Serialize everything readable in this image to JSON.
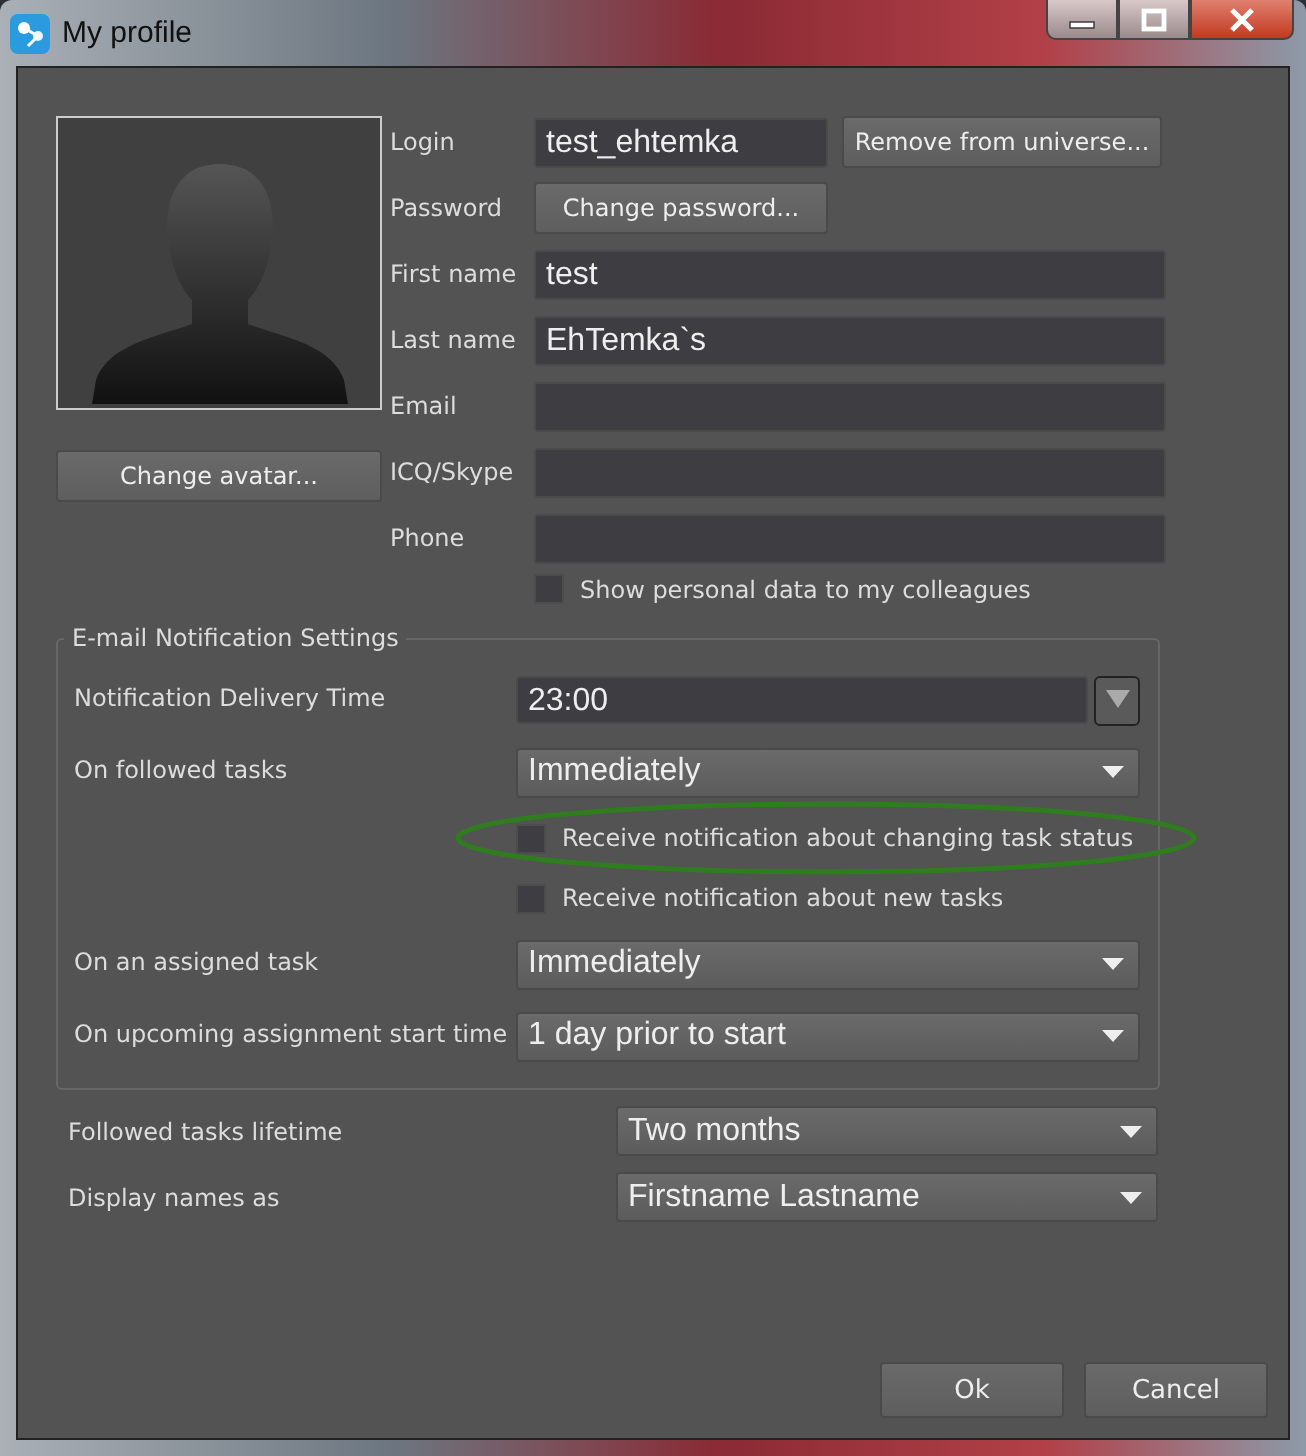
{
  "window": {
    "title": "My profile"
  },
  "profile": {
    "change_avatar": "Change avatar...",
    "fields": [
      {
        "label": "Login",
        "kind": "input",
        "value": "test_ehtemka",
        "button": "Remove from universe..."
      },
      {
        "label": "Password",
        "kind": "button",
        "button": "Change password..."
      },
      {
        "label": "First name",
        "kind": "input",
        "value": "test"
      },
      {
        "label": "Last name",
        "kind": "input",
        "value": "EhTemka`s"
      },
      {
        "label": "Email",
        "kind": "input"
      },
      {
        "label": "ICQ/Skype",
        "kind": "input"
      },
      {
        "label": "Phone",
        "kind": "input"
      }
    ],
    "show_personal": {
      "label": "Show personal data to my colleagues",
      "checked": false
    }
  },
  "notifications": {
    "title": "E-mail Notification Settings",
    "rows": [
      {
        "kind": "time",
        "label": "Notification Delivery Time",
        "value": "23:00"
      },
      {
        "kind": "combo",
        "label": "On followed tasks",
        "value": "Immediately"
      },
      {
        "kind": "checkbox",
        "label": "Receive notification about changing task status",
        "checked": false,
        "highlighted": true
      },
      {
        "kind": "checkbox",
        "label": "Receive notification about new tasks",
        "checked": false,
        "highlighted": false
      },
      {
        "kind": "combo",
        "label": "On an assigned task",
        "value": "Immediately"
      },
      {
        "kind": "combo",
        "label": "On upcoming assignment start time",
        "value": "1 day prior to start"
      }
    ]
  },
  "general": [
    {
      "label": "Followed tasks lifetime",
      "value": "Two months"
    },
    {
      "label": "Display names as",
      "value": "Firstname Lastname"
    }
  ],
  "buttons": [
    "Ok",
    "Cancel"
  ]
}
